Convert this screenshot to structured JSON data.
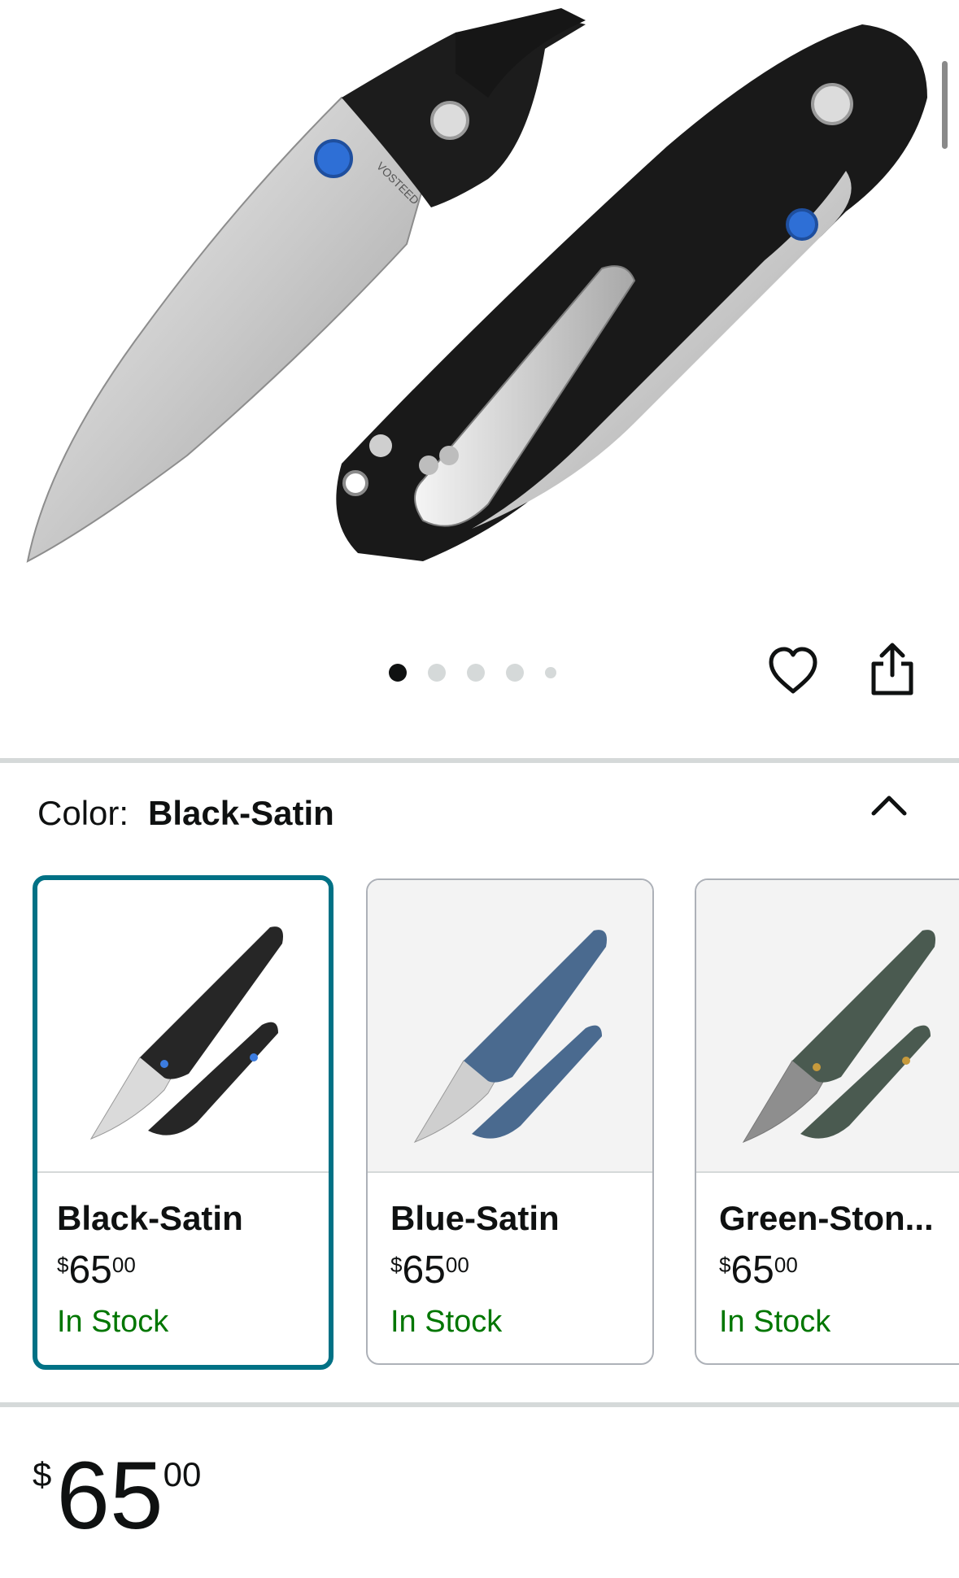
{
  "product_images": {
    "active_index": 0,
    "total": 5
  },
  "icons": {
    "favorite": "heart-outline-icon",
    "share": "share-icon",
    "collapse": "chevron-up-icon"
  },
  "color_selector": {
    "label": "Color:",
    "selected": "Black-Satin",
    "options": [
      {
        "name": "Black-Satin",
        "currency": "$",
        "price_whole": "65",
        "price_fraction": "00",
        "availability": "In Stock",
        "selected": true,
        "handle_color": "#262626"
      },
      {
        "name": "Blue-Satin",
        "currency": "$",
        "price_whole": "65",
        "price_fraction": "00",
        "availability": "In Stock",
        "selected": false,
        "handle_color": "#4a6a8f"
      },
      {
        "name": "Green-Ston...",
        "currency": "$",
        "price_whole": "65",
        "price_fraction": "00",
        "availability": "In Stock",
        "selected": false,
        "handle_color": "#4a5a50"
      }
    ]
  },
  "price": {
    "currency": "$",
    "whole": "65",
    "fraction": "00"
  },
  "colors": {
    "selected_border": "#007185",
    "in_stock": "#007600",
    "text": "#0f1111",
    "divider": "#d5d9d9"
  }
}
